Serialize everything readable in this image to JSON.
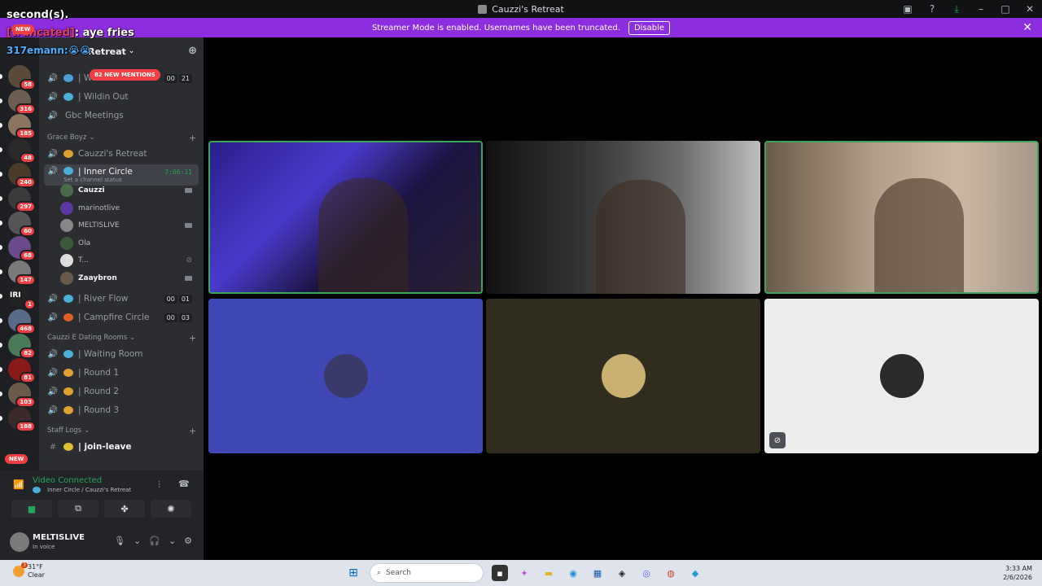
{
  "window": {
    "title": "Cauzzi's Retreat"
  },
  "banner": {
    "text": "Streamer Mode is enabled. Usernames have been truncated.",
    "button": "Disable"
  },
  "overlay": {
    "line1": "second(s).",
    "chat_user": "[truncated]",
    "chat_text": "aye fries",
    "line3_user": "317emann",
    "line3_emoji": "😭😭",
    "new_badge": "NEW"
  },
  "guild": {
    "name": "Cauzzi's Retreat",
    "header_suffix": "Retreat"
  },
  "mentions": "82 NEW MENTIONS",
  "servers": [
    {
      "badge": "58",
      "color": "#5a4a3a"
    },
    {
      "badge": "316",
      "color": "#6b5d52"
    },
    {
      "badge": "185",
      "color": "#8a7560"
    },
    {
      "badge": "48",
      "color": "#2a2a2a"
    },
    {
      "badge": "240",
      "color": "#4a3a2a"
    },
    {
      "badge": "297",
      "color": "#3a3a3a"
    },
    {
      "badge": "60",
      "color": "#555555"
    },
    {
      "badge": "68",
      "color": "#6a4a8a"
    },
    {
      "badge": "147",
      "color": "#7a7a7a"
    },
    {
      "badge": "1",
      "color": "#222222",
      "label": "IRI"
    },
    {
      "badge": "468",
      "color": "#5a6a8a"
    },
    {
      "badge": "82",
      "color": "#4a7a5a"
    },
    {
      "badge": "81",
      "color": "#8a1a1a"
    },
    {
      "badge": "103",
      "color": "#6a5a4a"
    },
    {
      "badge": "188",
      "color": "#3a2a2a"
    }
  ],
  "channels": {
    "top": [
      {
        "name": "| Wi...",
        "counts": [
          "00",
          "21"
        ],
        "emoji": "#4a9eda"
      },
      {
        "name": "| Wildin Out",
        "emoji": "#4ab0da"
      },
      {
        "name": "Gbc Meetings"
      }
    ],
    "cat1": "Grace Boyz",
    "cat1_items": [
      {
        "name": "Cauzzi's Retreat",
        "emoji": "#e0a030"
      }
    ],
    "active": {
      "name": "| Inner Circle",
      "timer": "7:06:11",
      "status": "Set a channel status"
    },
    "users": [
      {
        "name": "Cauzzi",
        "color": "#4a6a4a",
        "cam": true,
        "bold": true
      },
      {
        "name": "marinotlive",
        "color": "#5a3aa0"
      },
      {
        "name": "MELTISLIVE",
        "color": "#888888",
        "cam": true
      },
      {
        "name": "Ola",
        "color": "#3a5a3a"
      },
      {
        "name": "T...",
        "color": "#dddddd",
        "mute": true
      },
      {
        "name": "Zaaybron",
        "color": "#6a5a4a",
        "cam": true,
        "bold": true
      }
    ],
    "after": [
      {
        "name": "| River Flow",
        "counts": [
          "00",
          "01"
        ],
        "emoji": "#4ab0da"
      },
      {
        "name": "| Campfire Circle",
        "counts": [
          "00",
          "03"
        ],
        "emoji": "#e06020"
      }
    ],
    "cat2": "Cauzzi E Dating Rooms",
    "cat2_items": [
      {
        "name": "| Waiting Room",
        "emoji": "#4ab0da"
      },
      {
        "name": "| Round 1",
        "emoji": "#e0a030"
      },
      {
        "name": "| Round 2",
        "emoji": "#e0a030"
      },
      {
        "name": "| Round 3",
        "emoji": "#e0a030"
      }
    ],
    "cat3": "Staff Logs",
    "cat3_items": [
      {
        "name": "| join-leave",
        "emoji": "#e0c030"
      }
    ]
  },
  "voice": {
    "status": "Video Connected",
    "sub": "Inner Circle / Cauzzi's Retreat"
  },
  "me": {
    "name": "MELTISLIVE",
    "status": "In voice"
  },
  "tiles": [
    {
      "type": "video",
      "speaking": true,
      "bg": "linear-gradient(135deg,#2a1e8a 0%,#4a3acc 35%,#1a1440 60%,#2a2030 100%)"
    },
    {
      "type": "video",
      "speaking": false,
      "bg": "linear-gradient(90deg,#111 0%,#3a3a3a 40%,#6a6a6a 70%,#bdbdbd 100%)"
    },
    {
      "type": "video",
      "speaking": true,
      "bg": "linear-gradient(90deg,#6a5a4a 0%,#b0a08a 40%,#c9b9a4 70%,#a8988a 100%)"
    },
    {
      "type": "avatar",
      "bg": "#3f48b5",
      "avatar": "#3a3a6a"
    },
    {
      "type": "avatar",
      "bg": "#302c1e",
      "avatar": "#c9b070"
    },
    {
      "type": "avatar",
      "bg": "#ececec",
      "avatar": "#2a2a2a",
      "muted": true
    }
  ],
  "taskbar": {
    "weather_temp": "31°F",
    "weather_desc": "Clear",
    "weather_badge": "3",
    "search": "Search",
    "time": "3:33 AM",
    "date": "2/6/2026"
  }
}
